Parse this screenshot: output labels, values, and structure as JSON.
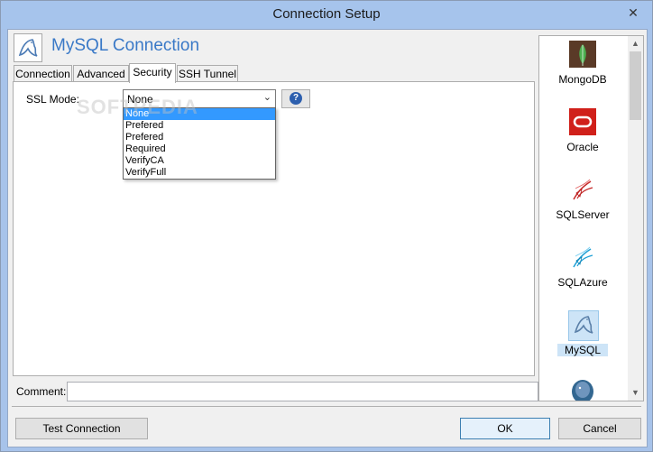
{
  "window": {
    "title": "Connection Setup",
    "close_glyph": "✕"
  },
  "header": {
    "title": "MySQL Connection",
    "icon": "mysql-dolphin-icon"
  },
  "tabs": [
    {
      "label": "Connection"
    },
    {
      "label": "Advanced"
    },
    {
      "label": "Security",
      "active": true
    },
    {
      "label": "SSH Tunnel"
    }
  ],
  "security": {
    "ssl_mode_label": "SSL Mode:",
    "ssl_mode_value": "None",
    "help_glyph": "?",
    "options": [
      "None",
      "Prefered",
      "Prefered",
      "Required",
      "VerifyCA",
      "VerifyFull"
    ],
    "selected_index": 0
  },
  "watermark": "SOFTPEDIA",
  "comment": {
    "label": "Comment:",
    "value": ""
  },
  "buttons": {
    "test": "Test Connection",
    "ok": "OK",
    "cancel": "Cancel"
  },
  "databases": [
    {
      "label": "MongoDB",
      "icon": "mongodb-leaf-icon",
      "color": "#5a3a27"
    },
    {
      "label": "Oracle",
      "icon": "oracle-icon",
      "color": "#d0201a"
    },
    {
      "label": "SQLServer",
      "icon": "sqlserver-icon",
      "color": "#c62828"
    },
    {
      "label": "SQLAzure",
      "icon": "sqlazure-icon",
      "color": "#1ea0d6"
    },
    {
      "label": "MySQL",
      "icon": "mysql-dolphin-icon",
      "color": "#5a7fa8",
      "selected": true
    },
    {
      "label": "",
      "icon": "postgresql-elephant-icon",
      "color": "#336791"
    }
  ],
  "colors": {
    "accent": "#3a79c7",
    "selection": "#3399ff",
    "titlebar": "#a6c4ec"
  }
}
